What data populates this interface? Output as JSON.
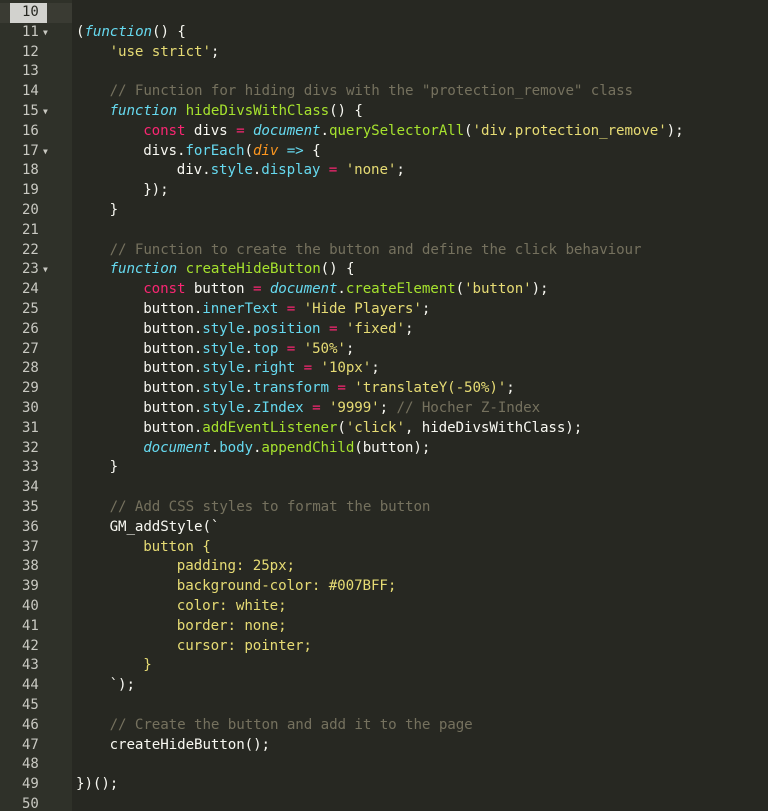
{
  "editor": {
    "active_line": 10,
    "folded_lines": [
      11,
      15,
      17,
      23
    ],
    "lines": [
      {
        "n": 10,
        "indent": 0,
        "tokens": []
      },
      {
        "n": 11,
        "indent": 0,
        "tokens": [
          [
            "plain",
            "("
          ],
          [
            "kw",
            "function"
          ],
          [
            "plain",
            "() {"
          ]
        ]
      },
      {
        "n": 12,
        "indent": 1,
        "tokens": [
          [
            "str",
            "'use strict'"
          ],
          [
            "plain",
            ";"
          ]
        ]
      },
      {
        "n": 13,
        "indent": 0,
        "tokens": []
      },
      {
        "n": 14,
        "indent": 1,
        "tokens": [
          [
            "cmt",
            "// Function for hiding divs with the \"protection_remove\" class"
          ]
        ]
      },
      {
        "n": 15,
        "indent": 1,
        "tokens": [
          [
            "kw",
            "function"
          ],
          [
            "plain",
            " "
          ],
          [
            "fn",
            "hideDivsWithClass"
          ],
          [
            "plain",
            "() {"
          ]
        ]
      },
      {
        "n": 16,
        "indent": 2,
        "tokens": [
          [
            "decl",
            "const"
          ],
          [
            "plain",
            " divs "
          ],
          [
            "op",
            "="
          ],
          [
            "plain",
            " "
          ],
          [
            "obj",
            "document"
          ],
          [
            "plain",
            "."
          ],
          [
            "fn",
            "querySelectorAll"
          ],
          [
            "plain",
            "("
          ],
          [
            "str",
            "'div.protection_remove'"
          ],
          [
            "plain",
            ");"
          ]
        ]
      },
      {
        "n": 17,
        "indent": 2,
        "tokens": [
          [
            "plain",
            "divs."
          ],
          [
            "prop",
            "forEach"
          ],
          [
            "plain",
            "("
          ],
          [
            "param",
            "div"
          ],
          [
            "plain",
            " "
          ],
          [
            "arrow",
            "=>"
          ],
          [
            "plain",
            " {"
          ]
        ]
      },
      {
        "n": 18,
        "indent": 3,
        "tokens": [
          [
            "plain",
            "div."
          ],
          [
            "prop",
            "style"
          ],
          [
            "plain",
            "."
          ],
          [
            "prop",
            "display"
          ],
          [
            "plain",
            " "
          ],
          [
            "op",
            "="
          ],
          [
            "plain",
            " "
          ],
          [
            "str",
            "'none'"
          ],
          [
            "plain",
            ";"
          ]
        ]
      },
      {
        "n": 19,
        "indent": 2,
        "tokens": [
          [
            "plain",
            "});"
          ]
        ]
      },
      {
        "n": 20,
        "indent": 1,
        "tokens": [
          [
            "plain",
            "}"
          ]
        ]
      },
      {
        "n": 21,
        "indent": 0,
        "tokens": []
      },
      {
        "n": 22,
        "indent": 1,
        "tokens": [
          [
            "cmt",
            "// Function to create the button and define the click behaviour"
          ]
        ]
      },
      {
        "n": 23,
        "indent": 1,
        "tokens": [
          [
            "kw",
            "function"
          ],
          [
            "plain",
            " "
          ],
          [
            "fn",
            "createHideButton"
          ],
          [
            "plain",
            "() {"
          ]
        ]
      },
      {
        "n": 24,
        "indent": 2,
        "tokens": [
          [
            "decl",
            "const"
          ],
          [
            "plain",
            " button "
          ],
          [
            "op",
            "="
          ],
          [
            "plain",
            " "
          ],
          [
            "obj",
            "document"
          ],
          [
            "plain",
            "."
          ],
          [
            "fn",
            "createElement"
          ],
          [
            "plain",
            "("
          ],
          [
            "str",
            "'button'"
          ],
          [
            "plain",
            ");"
          ]
        ]
      },
      {
        "n": 25,
        "indent": 2,
        "tokens": [
          [
            "plain",
            "button."
          ],
          [
            "prop",
            "innerText"
          ],
          [
            "plain",
            " "
          ],
          [
            "op",
            "="
          ],
          [
            "plain",
            " "
          ],
          [
            "str",
            "'Hide Players'"
          ],
          [
            "plain",
            ";"
          ]
        ]
      },
      {
        "n": 26,
        "indent": 2,
        "tokens": [
          [
            "plain",
            "button."
          ],
          [
            "prop",
            "style"
          ],
          [
            "plain",
            "."
          ],
          [
            "prop",
            "position"
          ],
          [
            "plain",
            " "
          ],
          [
            "op",
            "="
          ],
          [
            "plain",
            " "
          ],
          [
            "str",
            "'fixed'"
          ],
          [
            "plain",
            ";"
          ]
        ]
      },
      {
        "n": 27,
        "indent": 2,
        "tokens": [
          [
            "plain",
            "button."
          ],
          [
            "prop",
            "style"
          ],
          [
            "plain",
            "."
          ],
          [
            "prop",
            "top"
          ],
          [
            "plain",
            " "
          ],
          [
            "op",
            "="
          ],
          [
            "plain",
            " "
          ],
          [
            "str",
            "'50%'"
          ],
          [
            "plain",
            ";"
          ]
        ]
      },
      {
        "n": 28,
        "indent": 2,
        "tokens": [
          [
            "plain",
            "button."
          ],
          [
            "prop",
            "style"
          ],
          [
            "plain",
            "."
          ],
          [
            "prop",
            "right"
          ],
          [
            "plain",
            " "
          ],
          [
            "op",
            "="
          ],
          [
            "plain",
            " "
          ],
          [
            "str",
            "'10px'"
          ],
          [
            "plain",
            ";"
          ]
        ]
      },
      {
        "n": 29,
        "indent": 2,
        "tokens": [
          [
            "plain",
            "button."
          ],
          [
            "prop",
            "style"
          ],
          [
            "plain",
            "."
          ],
          [
            "prop",
            "transform"
          ],
          [
            "plain",
            " "
          ],
          [
            "op",
            "="
          ],
          [
            "plain",
            " "
          ],
          [
            "str",
            "'translateY(-50%)'"
          ],
          [
            "plain",
            ";"
          ]
        ]
      },
      {
        "n": 30,
        "indent": 2,
        "tokens": [
          [
            "plain",
            "button."
          ],
          [
            "prop",
            "style"
          ],
          [
            "plain",
            "."
          ],
          [
            "prop",
            "zIndex"
          ],
          [
            "plain",
            " "
          ],
          [
            "op",
            "="
          ],
          [
            "plain",
            " "
          ],
          [
            "str",
            "'9999'"
          ],
          [
            "plain",
            "; "
          ],
          [
            "cmt",
            "// Hocher Z-Index"
          ]
        ]
      },
      {
        "n": 31,
        "indent": 2,
        "tokens": [
          [
            "plain",
            "button."
          ],
          [
            "fn",
            "addEventListener"
          ],
          [
            "plain",
            "("
          ],
          [
            "str",
            "'click'"
          ],
          [
            "plain",
            ", hideDivsWithClass);"
          ]
        ]
      },
      {
        "n": 32,
        "indent": 2,
        "tokens": [
          [
            "obj",
            "document"
          ],
          [
            "plain",
            "."
          ],
          [
            "prop",
            "body"
          ],
          [
            "plain",
            "."
          ],
          [
            "fn",
            "appendChild"
          ],
          [
            "plain",
            "(button);"
          ]
        ]
      },
      {
        "n": 33,
        "indent": 1,
        "tokens": [
          [
            "plain",
            "}"
          ]
        ]
      },
      {
        "n": 34,
        "indent": 0,
        "tokens": []
      },
      {
        "n": 35,
        "indent": 1,
        "tokens": [
          [
            "cmt",
            "// Add CSS styles to format the button"
          ]
        ]
      },
      {
        "n": 36,
        "indent": 1,
        "tokens": [
          [
            "plain",
            "GM_addStyle(`"
          ]
        ]
      },
      {
        "n": 37,
        "indent": 2,
        "tokens": [
          [
            "str",
            "button {"
          ]
        ]
      },
      {
        "n": 38,
        "indent": 3,
        "tokens": [
          [
            "str",
            "padding: 25px;"
          ]
        ]
      },
      {
        "n": 39,
        "indent": 3,
        "tokens": [
          [
            "str",
            "background-color: #007BFF;"
          ]
        ]
      },
      {
        "n": 40,
        "indent": 3,
        "tokens": [
          [
            "str",
            "color: white;"
          ]
        ]
      },
      {
        "n": 41,
        "indent": 3,
        "tokens": [
          [
            "str",
            "border: none;"
          ]
        ]
      },
      {
        "n": 42,
        "indent": 3,
        "tokens": [
          [
            "str",
            "cursor: pointer;"
          ]
        ]
      },
      {
        "n": 43,
        "indent": 2,
        "tokens": [
          [
            "str",
            "}"
          ]
        ]
      },
      {
        "n": 44,
        "indent": 1,
        "tokens": [
          [
            "plain",
            "`);"
          ]
        ]
      },
      {
        "n": 45,
        "indent": 0,
        "tokens": []
      },
      {
        "n": 46,
        "indent": 1,
        "tokens": [
          [
            "cmt",
            "// Create the button and add it to the page"
          ]
        ]
      },
      {
        "n": 47,
        "indent": 1,
        "tokens": [
          [
            "plain",
            "createHideButton();"
          ]
        ]
      },
      {
        "n": 48,
        "indent": 0,
        "tokens": []
      },
      {
        "n": 49,
        "indent": 0,
        "tokens": [
          [
            "plain",
            "})();"
          ]
        ]
      },
      {
        "n": 50,
        "indent": 0,
        "tokens": []
      }
    ]
  }
}
